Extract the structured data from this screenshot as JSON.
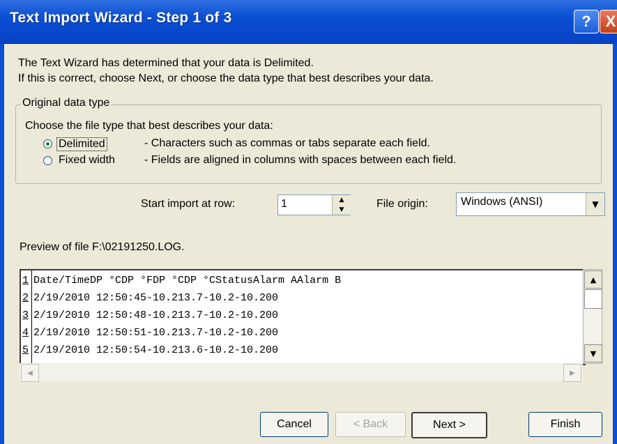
{
  "title": "Text Import Wizard - Step 1 of 3",
  "titlebar_buttons": {
    "help": "?",
    "close": "X"
  },
  "intro": {
    "line1": "The Text Wizard has determined that your data is Delimited.",
    "line2": "If this is correct, choose Next, or choose the data type that best describes your data."
  },
  "original_data_type": {
    "group_label": "Original data type",
    "prompt": "Choose the file type that best describes your data:",
    "options": [
      {
        "label": "Delimited",
        "description": "- Characters such as commas or tabs separate each field.",
        "selected": true
      },
      {
        "label": "Fixed width",
        "description": "- Fields are aligned in columns with spaces between each field.",
        "selected": false
      }
    ]
  },
  "start_row": {
    "label": "Start import at row:",
    "value": "1"
  },
  "file_origin": {
    "label": "File origin:",
    "value": "Windows (ANSI)"
  },
  "preview": {
    "label": "Preview of file F:\\02191250.LOG.",
    "rows": [
      {
        "num": "1",
        "text": "Date/TimeDP °CDP °FDP °CDP °CStatusAlarm AAlarm B"
      },
      {
        "num": "2",
        "text": "2/19/2010 12:50:45-10.213.7-10.2-10.200"
      },
      {
        "num": "3",
        "text": "2/19/2010 12:50:48-10.213.7-10.2-10.200"
      },
      {
        "num": "4",
        "text": "2/19/2010 12:50:51-10.213.7-10.2-10.200"
      },
      {
        "num": "5",
        "text": "2/19/2010 12:50:54-10.213.6-10.2-10.200"
      }
    ]
  },
  "buttons": {
    "cancel": "Cancel",
    "back": "< Back",
    "next": "Next >",
    "finish": "Finish"
  },
  "colors": {
    "titlebar": "#0a4fd4",
    "dialog_bg": "#ece9d8",
    "radio_dot": "#1f8a1f"
  }
}
